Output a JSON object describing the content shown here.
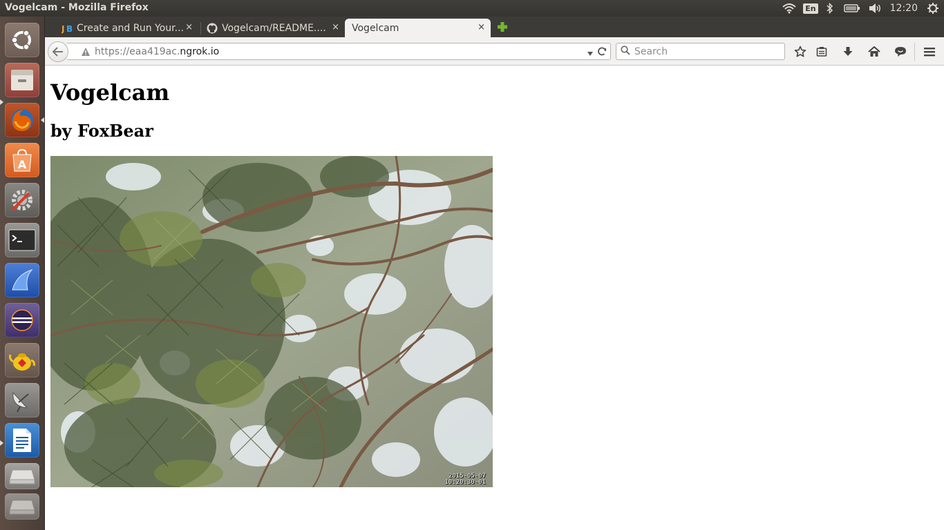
{
  "top_panel": {
    "window_title": "Vogelcam - Mozilla Firefox",
    "keyboard_layout": "En",
    "clock": "12:20",
    "icons": [
      "wifi-icon",
      "bluetooth-icon",
      "battery-icon",
      "volume-icon",
      "session-gear-icon"
    ]
  },
  "launcher": {
    "items": [
      {
        "name": "ubuntu-dash-icon"
      },
      {
        "name": "files-icon"
      },
      {
        "name": "firefox-icon"
      },
      {
        "name": "software-center-icon"
      },
      {
        "name": "system-settings-icon"
      },
      {
        "name": "terminal-icon"
      },
      {
        "name": "wireshark-icon"
      },
      {
        "name": "eclipse-icon"
      },
      {
        "name": "teapot-icon"
      },
      {
        "name": "satellite-dish-icon"
      },
      {
        "name": "libreoffice-writer-icon"
      },
      {
        "name": "drive-icon"
      },
      {
        "name": "drive-icon-2"
      }
    ]
  },
  "tabs": [
    {
      "label": "Create and Run Your...",
      "favicon": "jetbrains-icon",
      "close": "×"
    },
    {
      "label": "Vogelcam/README....",
      "favicon": "github-icon",
      "close": "×"
    },
    {
      "label": "Vogelcam",
      "favicon": "",
      "close": "×"
    }
  ],
  "navbar": {
    "url_prefix": "https://eaa419ac.",
    "url_domain": "ngrok.io",
    "search_placeholder": "Search"
  },
  "page": {
    "title": "Vogelcam",
    "subtitle": "by FoxBear",
    "cam_date": "2015-05-07",
    "cam_time": "10:20:30-01"
  },
  "colors": {
    "panel_bg": "#3c3b37",
    "chrome_bg": "#f2f1f0",
    "launcher_bg": "#5d4d44",
    "firefox_orange": "#e66000"
  }
}
